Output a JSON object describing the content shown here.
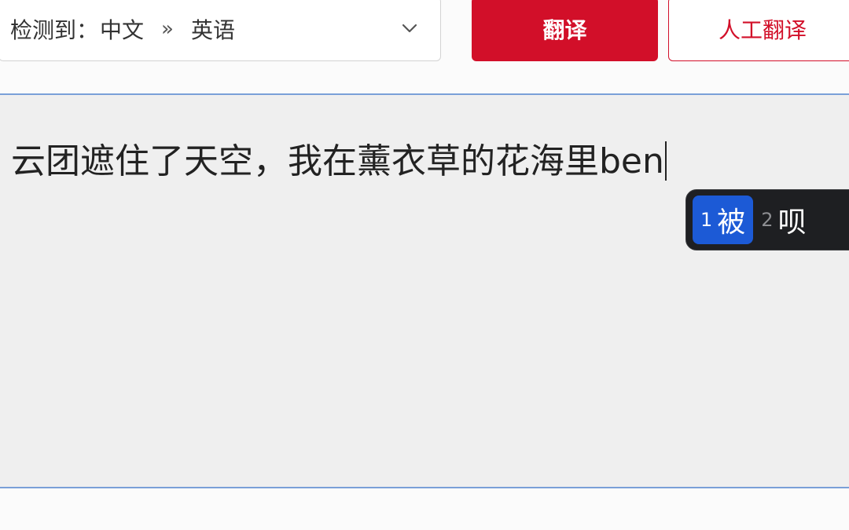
{
  "language_selector": {
    "detect_label": "检测到：",
    "source_language": "中文",
    "arrow": "»",
    "target_language": "英语"
  },
  "buttons": {
    "translate_label": "翻译",
    "human_translate_label": "人工翻译"
  },
  "input": {
    "text": "云团遮住了天空，我在薰衣草的花海里ben"
  },
  "ime": {
    "candidates": [
      {
        "index": "1",
        "text": "被",
        "selected": true
      },
      {
        "index": "2",
        "text": "呗",
        "selected": false
      }
    ]
  },
  "colors": {
    "brand_red": "#d20f29",
    "focus_border": "#7aa0d8",
    "ime_highlight": "#1c5ad6"
  }
}
